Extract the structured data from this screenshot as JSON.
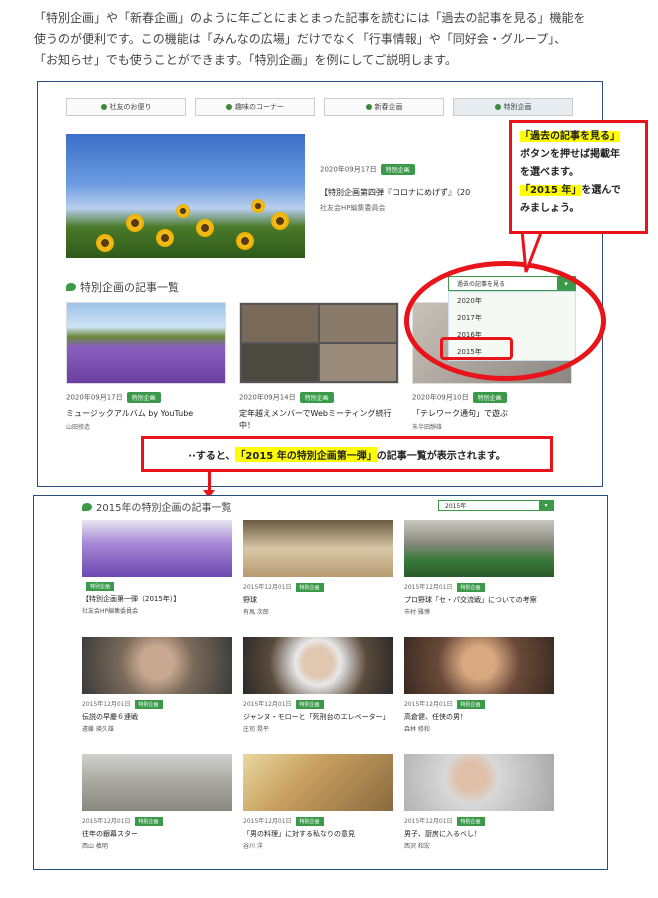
{
  "intro": [
    "「特別企画」や「新春企画」のように年ごとにまとまった記事を読むには「過去の記事を見る」機能を",
    "使うのが便利です。この機能は「みんなの広場」だけでなく「行事情報」や「同好会・グループ」、",
    "「お知らせ」でも使うことができます。「特別企画」を例にしてご説明します。"
  ],
  "tabs": [
    "社友のお便り",
    "趣味のコーナー",
    "新春企画",
    "特別企画"
  ],
  "hero": {
    "date": "2020年09月17日",
    "badge": "特別企画",
    "title": "【特別企画第四弾『コロナにめげず』（20",
    "author": "社友会HP編集委員会"
  },
  "section1": "特別企画の記事一覧",
  "dropdown": {
    "label": "過去の記事を見る",
    "arrow": "▾",
    "options": [
      "2020年",
      "2017年",
      "2016年",
      "2015年"
    ]
  },
  "cards1": [
    {
      "date": "2020年09月17日",
      "badge": "特別企画",
      "title": "ミュージックアルバム by YouTube",
      "author": "山田修造"
    },
    {
      "date": "2020年09月14日",
      "badge": "特別企画",
      "title": "定年越えメンバーでWebミーティング続行中！",
      "author": ""
    },
    {
      "date": "2020年09月10日",
      "badge": "特別企画",
      "title": "「テレワーク通句」で遊ぶ",
      "author": "朱半田靜雄"
    }
  ],
  "callout": {
    "l1": "「過去の記事を見る」",
    "l2": "ボタンを押せば掲載年",
    "l3": "を選べます。",
    "l4": "「2015 年」",
    "l5": "を選んで",
    "l6": "みましょう。"
  },
  "callout2": {
    "pre": "··すると、",
    "hl": "「2015 年の特別企画第一弾」",
    "post": "の記事一覧が表示されます。"
  },
  "section2": "2015年の特別企画の記事一覧",
  "dropdown2": {
    "label": "2015年",
    "arrow": "▾"
  },
  "cards2": [
    {
      "date": "",
      "badge": "特別企画",
      "title": "【特別企画第一弾（2015年）】",
      "author": "社友会HP編集委員会"
    },
    {
      "date": "2015年12月01日",
      "badge": "特別企画",
      "title": "野球",
      "author": "有馬 次郎"
    },
    {
      "date": "2015年12月01日",
      "badge": "特別企画",
      "title": "プロ野球「セ・パ交流戦」についての考察",
      "author": "市村 雅博"
    },
    {
      "date": "2015年12月01日",
      "badge": "特別企画",
      "title": "伝説の早慶６連戦",
      "author": "遠藤 瑛久雄"
    },
    {
      "date": "2015年12月01日",
      "badge": "特別企画",
      "title": "ジャンヌ・モローと「死刑台のエレベーター」",
      "author": "庄司 晃平"
    },
    {
      "date": "2015年12月01日",
      "badge": "特別企画",
      "title": "高倉健、任侠の男！",
      "author": "森林 修和"
    },
    {
      "date": "2015年12月01日",
      "badge": "特別企画",
      "title": "往年の銀幕スター",
      "author": "西山 槙明"
    },
    {
      "date": "2015年12月01日",
      "badge": "特別企画",
      "title": "「男の料理」に対する私なりの意見",
      "author": "谷川 洋"
    },
    {
      "date": "2015年12月01日",
      "badge": "特別企画",
      "title": "男子、厨房に入るべし！",
      "author": "西沢 和宏"
    }
  ]
}
